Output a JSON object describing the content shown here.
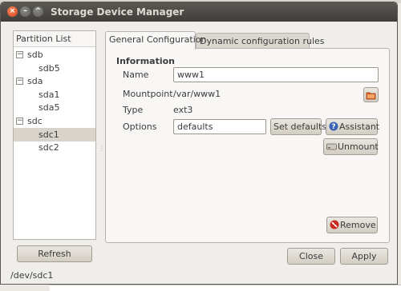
{
  "window": {
    "title": "Storage Device Manager"
  },
  "partition_list": {
    "header": "Partition List",
    "items": [
      {
        "label": "sdb",
        "level": 0,
        "expander": "−"
      },
      {
        "label": "sdb5",
        "level": 1
      },
      {
        "label": "sda",
        "level": 0,
        "expander": "−"
      },
      {
        "label": "sda1",
        "level": 1
      },
      {
        "label": "sda5",
        "level": 1
      },
      {
        "label": "sdc",
        "level": 0,
        "expander": "−"
      },
      {
        "label": "sdc1",
        "level": 1,
        "selected": true
      },
      {
        "label": "sdc2",
        "level": 1
      }
    ]
  },
  "tabs": {
    "general": "General Configuration",
    "dynamic": "Dynamic configuration rules"
  },
  "info": {
    "section_title": "Information",
    "name_label": "Name",
    "name_value": "www1",
    "mountpoint_label": "Mountpoint",
    "mountpoint_value": "/var/www1",
    "type_label": "Type",
    "type_value": "ext3",
    "options_label": "Options",
    "options_value": "defaults"
  },
  "buttons": {
    "set_defaults": "Set defaults",
    "assistant": "Assistant",
    "unmount": "Unmount",
    "remove": "Remove",
    "refresh": "Refresh",
    "close": "Close",
    "apply": "Apply"
  },
  "status": {
    "device_path": "/dev/sdc1"
  },
  "colors": {
    "titlebar": "#3e3d39",
    "close_button": "#d8471e",
    "selection": "#d9d4cb",
    "folder_icon": "#e0641e",
    "help_icon": "#3b63b5",
    "remove_icon": "#c8281e"
  }
}
